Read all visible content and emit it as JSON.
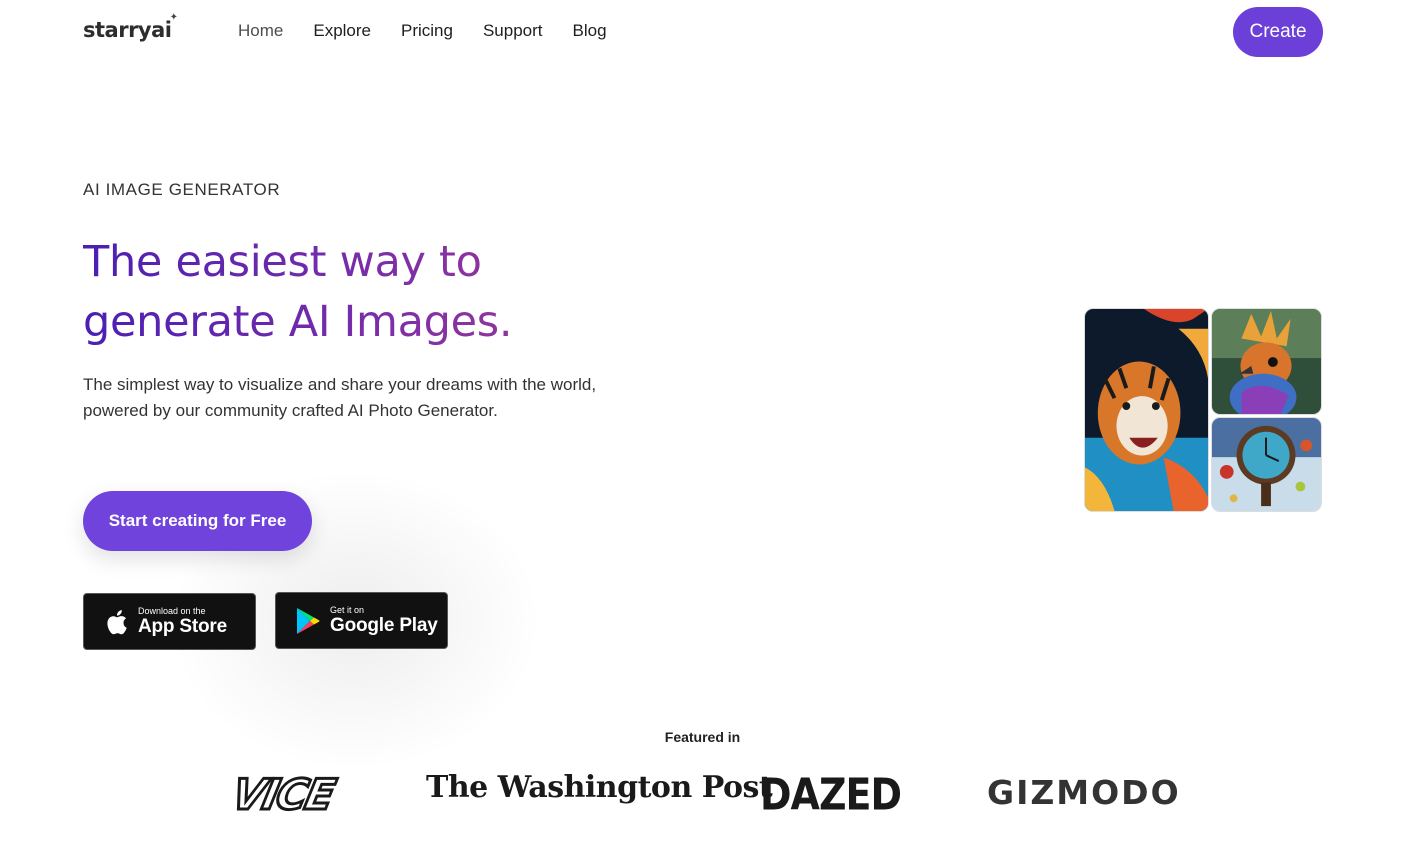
{
  "header": {
    "logo": "starryai",
    "nav": [
      "Home",
      "Explore",
      "Pricing",
      "Support",
      "Blog"
    ],
    "create_label": "Create"
  },
  "hero": {
    "eyebrow": "AI IMAGE GENERATOR",
    "headline_line1": "The easiest way to",
    "headline_line2": "generate AI Images.",
    "subtext": "The simplest way to visualize and share your dreams with the world, powered by our community crafted AI Photo Generator.",
    "cta_label": "Start creating for Free",
    "app_store": {
      "small": "Download on the",
      "big": "App Store"
    },
    "google_play": {
      "small": "Get it on",
      "big": "Google Play"
    }
  },
  "colors": {
    "accent": "#6c3fd8",
    "headline_gradient": [
      "#4b1fb3",
      "#a23c8f"
    ]
  },
  "featured": {
    "label": "Featured in",
    "logos": [
      "VICE",
      "The Washington Post",
      "DAZED",
      "GIZMODO"
    ]
  }
}
